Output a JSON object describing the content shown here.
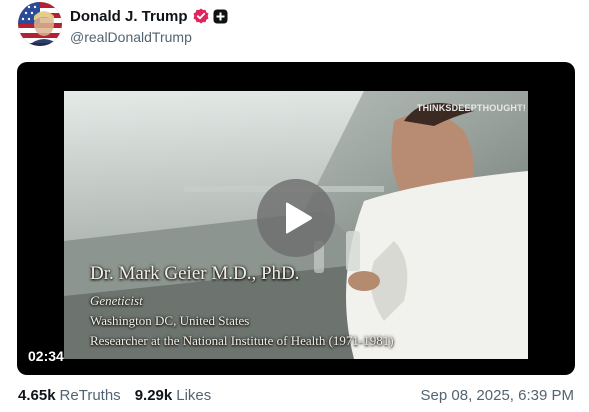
{
  "author": {
    "display_name": "Donald J. Trump",
    "handle": "@realDonaldTrump",
    "verified_badge_icon": "verified-check-badge-icon",
    "verified_badge_color": "#e0245e",
    "secondary_badge_icon": "plus-badge-icon"
  },
  "video": {
    "watermark": "THINKSDEEPTHOUGHT!",
    "caption": {
      "name": "Dr. Mark Geier M.D., PhD.",
      "role": "Geneticist",
      "location": "Washington DC, United States",
      "research": "Researcher at the National Institute of Health (1971-1981)"
    },
    "duration": "02:34",
    "play_icon": "play-icon"
  },
  "stats": {
    "retruths_count": "4.65k",
    "retruths_label": "ReTruths",
    "likes_count": "9.29k",
    "likes_label": "Likes"
  },
  "timestamp": "Sep 08, 2025, 6:39 PM"
}
